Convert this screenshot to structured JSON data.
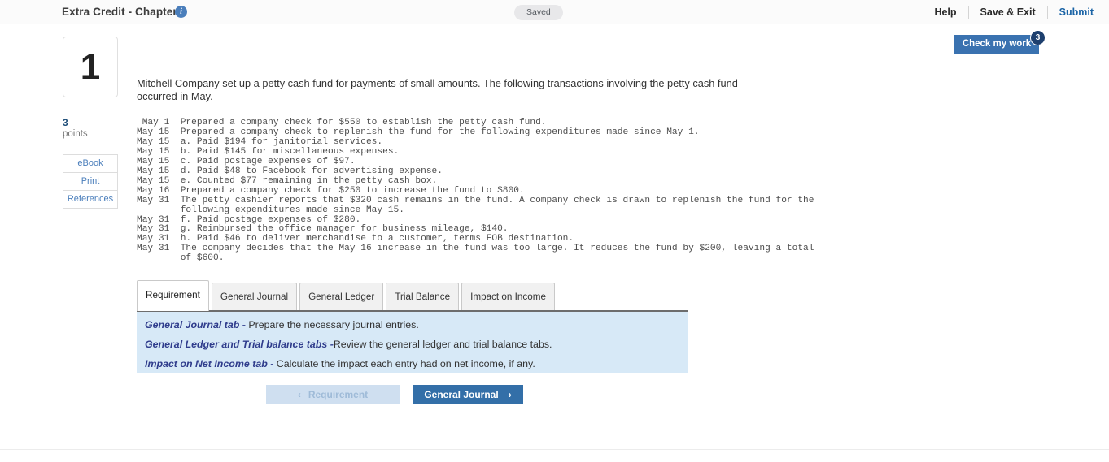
{
  "header": {
    "title": "Extra Credit - Chapter 8",
    "info_icon": "info-icon",
    "saved_status": "Saved",
    "help_label": "Help",
    "save_exit_label": "Save & Exit",
    "submit_label": "Submit"
  },
  "check_work": {
    "label": "Check my work",
    "badge_count": "3"
  },
  "sidebar": {
    "question_number": "1",
    "points_value": "3",
    "points_label": "points",
    "links": [
      {
        "label": "eBook"
      },
      {
        "label": "Print"
      },
      {
        "label": "References"
      }
    ]
  },
  "main": {
    "intro": "Mitchell Company set up a petty cash fund for payments of small amounts. The following transactions involving the petty cash fund occurred in May.",
    "transactions": " May 1  Prepared a company check for $550 to establish the petty cash fund.\nMay 15  Prepared a company check to replenish the fund for the following expenditures made since May 1.\nMay 15  a. Paid $194 for janitorial services.\nMay 15  b. Paid $145 for miscellaneous expenses.\nMay 15  c. Paid postage expenses of $97.\nMay 15  d. Paid $48 to Facebook for advertising expense.\nMay 15  e. Counted $77 remaining in the petty cash box.\nMay 16  Prepared a company check for $250 to increase the fund to $800.\nMay 31  The petty cashier reports that $320 cash remains in the fund. A company check is drawn to replenish the fund for the\n        following expenditures made since May 15.\nMay 31  f. Paid postage expenses of $280.\nMay 31  g. Reimbursed the office manager for business mileage, $140.\nMay 31  h. Paid $46 to deliver merchandise to a customer, terms FOB destination.\nMay 31  The company decides that the May 16 increase in the fund was too large. It reduces the fund by $200, leaving a total\n        of $600."
  },
  "tabs": [
    {
      "label": "Requirement",
      "active": true
    },
    {
      "label": "General Journal",
      "active": false
    },
    {
      "label": "General Ledger",
      "active": false
    },
    {
      "label": "Trial Balance",
      "active": false
    },
    {
      "label": "Impact on Income",
      "active": false
    }
  ],
  "requirement_panel": {
    "lines": [
      {
        "emphasis": "General Journal tab -",
        "rest": " Prepare the necessary journal entries."
      },
      {
        "emphasis": "General Ledger and Trial balance tabs -",
        "rest": "Review the general ledger and trial balance tabs."
      },
      {
        "emphasis": "Impact on Net Income tab -",
        "rest": " Calculate the impact each entry had on net income, if any."
      }
    ]
  },
  "footer_nav": {
    "prev_label": "Requirement",
    "prev_chevron": "chevron-left-icon",
    "prev_chevron_glyph": "‹",
    "next_label": "General Journal",
    "next_chevron": "chevron-right-icon",
    "next_chevron_glyph": "›"
  },
  "colors": {
    "accent_blue": "#3a72b0",
    "link_blue": "#4a7ebb",
    "panel_blue": "#d7e9f7",
    "emphasis_navy": "#2f3c8c",
    "badge_navy": "#1d3f6e",
    "disabled_blue": "#cfdff0"
  }
}
